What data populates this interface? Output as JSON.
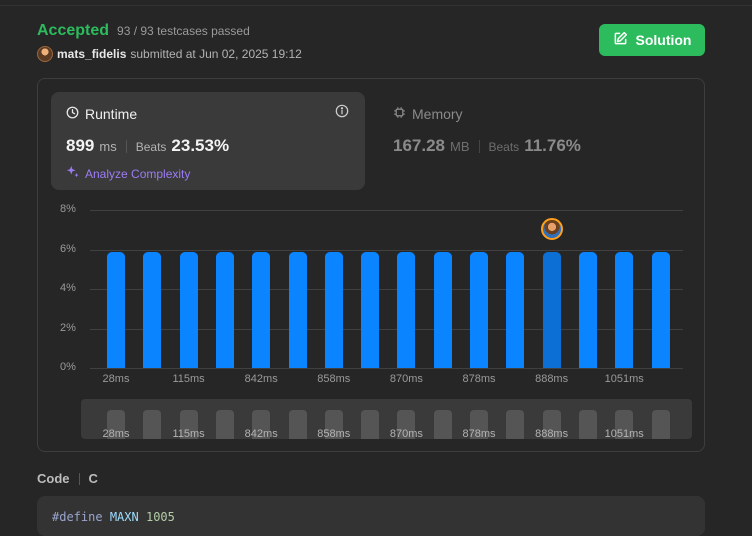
{
  "status": {
    "label": "Accepted",
    "testcases": "93 / 93 testcases passed"
  },
  "submission": {
    "username": "mats_fidelis",
    "submitted_text": "submitted at Jun 02, 2025 19:12"
  },
  "solution_button": {
    "label": "Solution",
    "icon": "edit-icon"
  },
  "runtime": {
    "title": "Runtime",
    "value": "899",
    "unit": "ms",
    "beats_label": "Beats",
    "beats_value": "23.53%",
    "analyze_label": "Analyze Complexity"
  },
  "memory": {
    "title": "Memory",
    "value": "167.28",
    "unit": "MB",
    "beats_label": "Beats",
    "beats_value": "11.76%"
  },
  "colors": {
    "accent_green": "#2cbb5d",
    "bar_blue": "#0a84ff",
    "analyze_purple": "#9c7cf4"
  },
  "chart_data": {
    "type": "bar",
    "yticks": [
      "8%",
      "6%",
      "4%",
      "2%",
      "0%"
    ],
    "ylim": [
      0,
      8
    ],
    "values": [
      5.88,
      5.88,
      5.88,
      5.88,
      5.88,
      5.88,
      5.88,
      5.88,
      5.88,
      5.88,
      5.88,
      5.88,
      5.88,
      5.88,
      5.88,
      5.88
    ],
    "highlight_index": 12,
    "xtick_labels": [
      "28ms",
      "115ms",
      "842ms",
      "858ms",
      "870ms",
      "878ms",
      "888ms",
      "1051ms"
    ],
    "grid": true
  },
  "code": {
    "header_label": "Code",
    "language": "C",
    "first_line": {
      "hash": "#",
      "keyword": "define",
      "name": "MAXN",
      "value": "1005"
    }
  }
}
